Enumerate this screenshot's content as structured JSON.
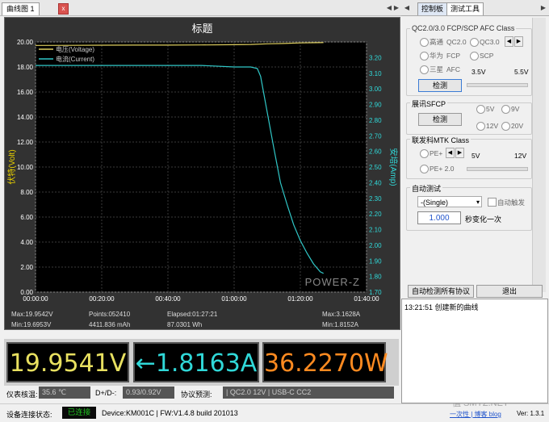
{
  "tabs": {
    "chart_tab": "曲线图 1",
    "close": "x"
  },
  "chart": {
    "title": "标题",
    "left_axis_label": "伏特(Volt)",
    "right_axis_label": "安培(Amp)",
    "legend_voltage": "电压(Voltage)",
    "legend_current": "电流(Current)",
    "watermark": "POWER-Z",
    "stats": {
      "max_v": "Max:19.9542V",
      "min_v": "Min:19.6953V",
      "points": "Points:052410",
      "mah": "4411.836 mAh",
      "elapsed": "Elapsed:01:27:21",
      "wh": "87.0301 Wh",
      "max_a": "Max:3.1628A",
      "min_a": "Min:1.8152A"
    }
  },
  "chart_data": {
    "type": "line",
    "title": "标题",
    "xlabel": "",
    "ylabel": "伏特(Volt)",
    "y2label": "安培(Amp)",
    "x_ticks": [
      "00:00:00",
      "00:20:00",
      "00:40:00",
      "01:00:00",
      "01:20:00",
      "01:40:00"
    ],
    "xlim_minutes": [
      0,
      100
    ],
    "ylim": [
      0,
      20
    ],
    "y_ticks": [
      "0.00",
      "2.00",
      "4.00",
      "6.00",
      "8.00",
      "10.00",
      "12.00",
      "14.00",
      "16.00",
      "18.00",
      "20.00"
    ],
    "y2lim": [
      1.7,
      3.3
    ],
    "y2_ticks": [
      "1.70",
      "1.80",
      "1.90",
      "2.00",
      "2.10",
      "2.20",
      "2.30",
      "2.40",
      "2.50",
      "2.60",
      "2.70",
      "2.80",
      "2.90",
      "3.00",
      "3.10",
      "3.20"
    ],
    "grid": true,
    "legend": "top-left",
    "series": [
      {
        "name": "电压(Voltage)",
        "axis": "left",
        "color": "#e0d060",
        "x": [
          0,
          10,
          20,
          30,
          40,
          50,
          60,
          65,
          70,
          75,
          80,
          85,
          87
        ],
        "y": [
          19.72,
          19.73,
          19.74,
          19.75,
          19.75,
          19.76,
          19.78,
          19.8,
          19.85,
          19.88,
          19.92,
          19.94,
          19.95
        ]
      },
      {
        "name": "电流(Current)",
        "axis": "right",
        "color": "#30c8c8",
        "x": [
          0,
          10,
          20,
          30,
          40,
          50,
          60,
          65,
          67,
          68,
          70,
          72,
          74,
          76,
          78,
          80,
          82,
          84,
          86,
          87
        ],
        "y": [
          3.15,
          3.15,
          3.15,
          3.15,
          3.15,
          3.15,
          3.14,
          3.14,
          3.13,
          3.08,
          2.85,
          2.62,
          2.4,
          2.26,
          2.13,
          2.03,
          1.95,
          1.88,
          1.83,
          1.82
        ]
      }
    ]
  },
  "readouts": {
    "voltage": "19.9541V",
    "current": "←1.8163A",
    "power": "36.2270W"
  },
  "info": {
    "temp_label": "仪表核温:",
    "temp_value": "35.6 ℃",
    "dpdm_label": "D+/D-:",
    "dpdm_value": "0.93/0.92V",
    "protocol_label": "协议预测:",
    "protocol_value": "| QC2.0 12V | USB-C CC2"
  },
  "status": {
    "label": "设备连接状态:",
    "connected": "已连接",
    "device": "Device:KM001C | FW:V1.4.8 build 201013",
    "links": "一次性 | 博客 blog",
    "version": "Ver: 1.3.1",
    "watermark": "值 SMYZ.NET"
  },
  "right": {
    "tabs": {
      "control": "控制板",
      "tools": "测试工具"
    },
    "qc": {
      "title": "QC2.0/3.0 FCP/SCP AFC Class",
      "gaotong": "高通",
      "qc20": "QC2.0",
      "qc30": "QC3.0",
      "huawei": "华为",
      "fcp": "FCP",
      "scp": "SCP",
      "sanxing": "三星",
      "afc": "AFC",
      "v_min": "3.5V",
      "v_max": "5.5V",
      "detect": "检测"
    },
    "sfcp": {
      "title": "展讯SFCP",
      "detect": "检测",
      "v5": "5V",
      "v9": "9V",
      "v12": "12V",
      "v20": "20V"
    },
    "mtk": {
      "title": "联发科MTK Class",
      "pe_plus": "PE+",
      "pe_plus20": "PE+ 2.0",
      "v_min": "5V",
      "v_max": "12V"
    },
    "auto": {
      "title": "自动测试",
      "mode": "-(Single)",
      "auto_trigger": "自动触发",
      "seconds": "1.000",
      "seconds_suffix": "秒变化一次"
    },
    "auto_detect_all": "自动检测所有协议",
    "exit": "退出",
    "log": "13:21:51 创建新的曲线"
  },
  "colors": {
    "voltage": "#e8e060",
    "current": "#30d8d8",
    "power": "#ff8a20",
    "connected": "#20c020"
  }
}
